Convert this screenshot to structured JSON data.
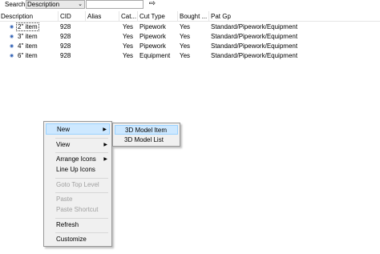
{
  "search": {
    "label": "Search",
    "field_value": "Description",
    "query_value": "",
    "go_icon": "arrow-right-icon"
  },
  "columns": [
    "Description",
    "CID",
    "Alias",
    "Cat...",
    "Cut Type",
    "Bought ...",
    "Pat Gp"
  ],
  "rows": [
    {
      "description": "2\" item",
      "cid": "928",
      "alias": "",
      "cat": "Yes",
      "cut_type": "Pipework",
      "bought": "Yes",
      "pat_gp": "Standard/Pipework/Equipment"
    },
    {
      "description": "3\" item",
      "cid": "928",
      "alias": "",
      "cat": "Yes",
      "cut_type": "Pipework",
      "bought": "Yes",
      "pat_gp": "Standard/Pipework/Equipment"
    },
    {
      "description": "4\" item",
      "cid": "928",
      "alias": "",
      "cat": "Yes",
      "cut_type": "Pipework",
      "bought": "Yes",
      "pat_gp": "Standard/Pipework/Equipment"
    },
    {
      "description": "6\" item",
      "cid": "928",
      "alias": "",
      "cat": "Yes",
      "cut_type": "Equipment",
      "bought": "Yes",
      "pat_gp": "Standard/Pipework/Equipment"
    }
  ],
  "context_menu": {
    "new": "New",
    "view": "View",
    "arrange_icons": "Arrange Icons",
    "line_up_icons": "Line Up Icons",
    "goto_top_level": "Goto Top Level",
    "paste": "Paste",
    "paste_shortcut": "Paste Shortcut",
    "refresh": "Refresh",
    "customize": "Customize"
  },
  "submenu": {
    "model_item": "3D Model Item",
    "model_list": "3D Model List"
  }
}
